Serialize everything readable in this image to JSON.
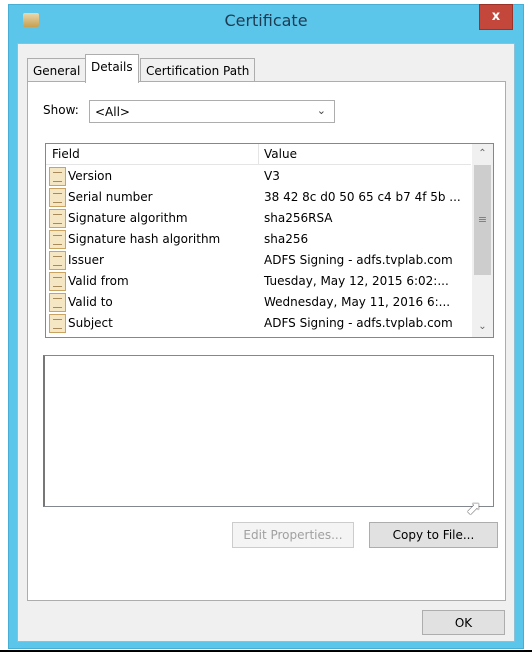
{
  "window": {
    "title": "Certificate",
    "close_label": "x"
  },
  "tabs": [
    {
      "label": "General"
    },
    {
      "label": "Details",
      "active": true
    },
    {
      "label": "Certification Path"
    }
  ],
  "show": {
    "label": "Show:",
    "value": "<All>"
  },
  "list": {
    "columns": [
      "Field",
      "Value"
    ],
    "rows": [
      {
        "field": "Version",
        "value": "V3"
      },
      {
        "field": "Serial number",
        "value": "38 42 8c d0 50 65 c4 b7 4f 5b ..."
      },
      {
        "field": "Signature algorithm",
        "value": "sha256RSA"
      },
      {
        "field": "Signature hash algorithm",
        "value": "sha256"
      },
      {
        "field": "Issuer",
        "value": "ADFS Signing - adfs.tvplab.com"
      },
      {
        "field": "Valid from",
        "value": "Tuesday, May 12, 2015 6:02:..."
      },
      {
        "field": "Valid to",
        "value": "Wednesday, May 11, 2016 6:..."
      },
      {
        "field": "Subject",
        "value": "ADFS Signing - adfs.tvplab.com"
      }
    ]
  },
  "buttons": {
    "edit_properties": "Edit Properties...",
    "copy_to_file": "Copy to File...",
    "ok": "OK"
  },
  "colors": {
    "frame": "#5cc6ea",
    "close": "#c4473b"
  }
}
